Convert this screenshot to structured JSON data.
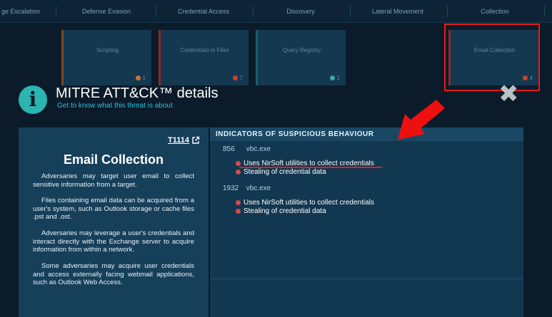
{
  "tactics": [
    {
      "label": "ge Escalation"
    },
    {
      "label": "Defense Evasion"
    },
    {
      "label": "Credential Access"
    },
    {
      "label": "Discovery"
    },
    {
      "label": "Lateral Movement"
    },
    {
      "label": "Collection"
    }
  ],
  "cards": [
    {
      "label": "Scripting",
      "count": "1",
      "dot_color": "#c9752a"
    },
    {
      "label": "Credentials in Files",
      "count": "7",
      "dot_color": "#c9402e"
    },
    {
      "label": "Query Registry",
      "count": "1",
      "dot_color": "#3fa7a6"
    },
    {
      "label": "Email Collection",
      "count": "4",
      "dot_color": "#c9402e"
    }
  ],
  "header": {
    "title": "MITRE ATT&CK™ details",
    "subtitle": "Get to know what this threat is about",
    "info_icon": "info-icon",
    "close_icon": "close-icon"
  },
  "technique": {
    "id": "T1114",
    "name": "Email Collection",
    "paragraphs": [
      "Adversaries may target user email to collect sensitive information from a target.",
      "Files containing email data can be acquired from a user's system, such as Outlook storage or cache files .pst and .ost.",
      "Adversaries may leverage a user's credentials and interact directly with the Exchange server to acquire information from within a network.",
      "Some adversaries may acquire user credentials and access externally facing webmail applications, such as Outlook Web Access."
    ]
  },
  "indicators": {
    "heading": "INDICATORS OF SUSPICIOUS BEHAVIOUR",
    "processes": [
      {
        "pid": "856",
        "name": "vbc.exe",
        "items": [
          "Uses NirSoft utilities to collect credentials",
          "Stealing of credential data"
        ]
      },
      {
        "pid": "1932",
        "name": "vbc.exe",
        "items": [
          "Uses NirSoft utilities to collect credentials",
          "Stealing of credential data"
        ]
      }
    ]
  },
  "colors": {
    "accent": "#2fc0d8",
    "annotation_red": "#e81b1b",
    "indicator_dot": "#d94a4a"
  }
}
